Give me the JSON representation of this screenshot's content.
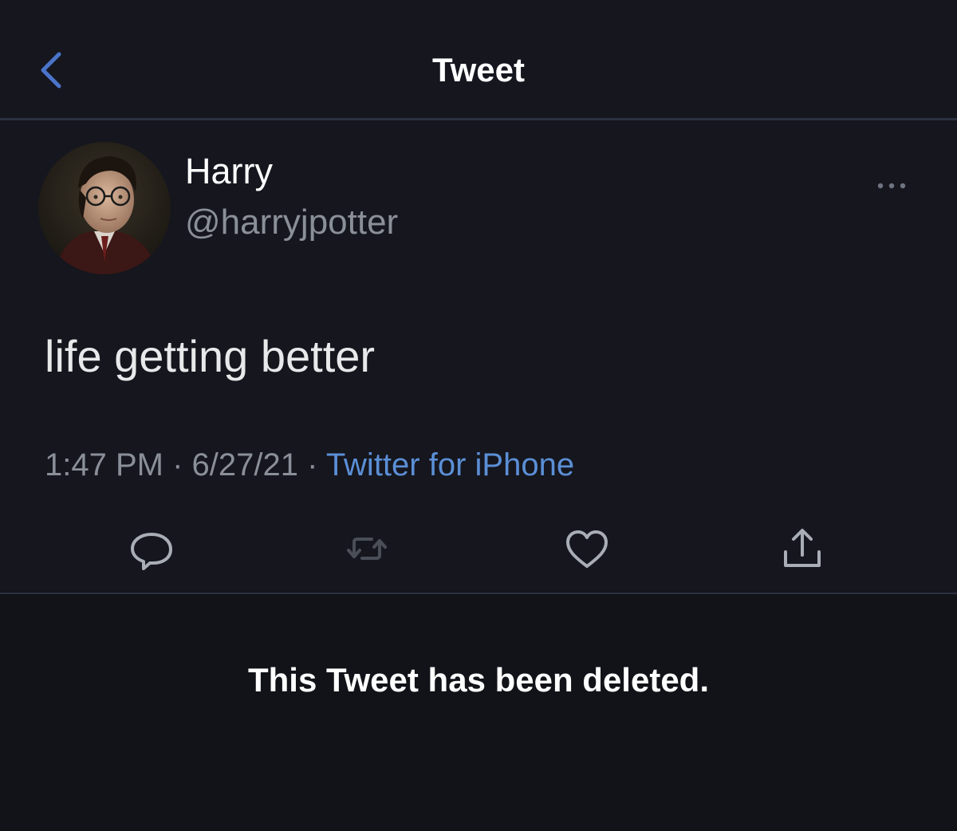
{
  "header": {
    "title": "Tweet",
    "back_icon": "chevron-left-icon"
  },
  "tweet": {
    "author": {
      "display_name": "Harry",
      "handle": "@harryjpotter"
    },
    "more_icon": "more-dots-icon",
    "text": "life getting better",
    "time": "1:47 PM",
    "separator": " · ",
    "date": "6/27/21",
    "source": "Twitter for iPhone",
    "actions": [
      {
        "name": "reply",
        "icon": "reply-icon"
      },
      {
        "name": "retweet",
        "icon": "retweet-icon"
      },
      {
        "name": "like",
        "icon": "heart-icon"
      },
      {
        "name": "share",
        "icon": "share-icon"
      }
    ]
  },
  "deleted_notice": {
    "text": "This Tweet has been deleted."
  },
  "colors": {
    "background": "#15161e",
    "divider": "#2b3140",
    "secondary_text": "#8a8f98",
    "link": "#5b8fd6",
    "accent_back": "#4a74c9"
  }
}
